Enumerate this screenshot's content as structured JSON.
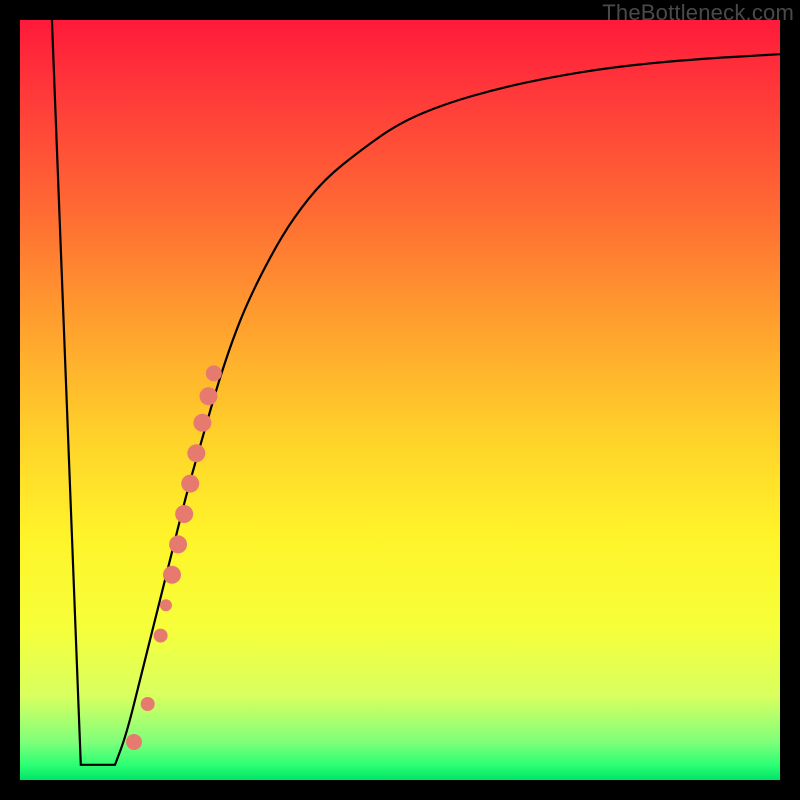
{
  "watermark": "TheBottleneck.com",
  "colors": {
    "curve_stroke": "#000000",
    "marker_fill": "#e77a6f",
    "marker_stroke": "#c95a4f"
  },
  "chart_data": {
    "type": "line",
    "title": "",
    "xlabel": "",
    "ylabel": "",
    "xlim": [
      0,
      100
    ],
    "ylim": [
      0,
      100
    ],
    "curve": {
      "x": [
        4.2,
        8.0,
        10.0,
        11.8,
        14.0,
        16.0,
        18.0,
        20.0,
        22.0,
        24.0,
        26.0,
        28.0,
        30.0,
        33.0,
        36.0,
        40.0,
        45.0,
        50.0,
        56.0,
        63.0,
        70.0,
        78.0,
        88.0,
        100.0
      ],
      "y": [
        100.0,
        4.0,
        2.0,
        2.0,
        6.0,
        14.0,
        22.0,
        30.0,
        38.0,
        45.0,
        52.0,
        58.0,
        63.0,
        69.0,
        74.0,
        79.0,
        83.0,
        86.5,
        89.0,
        91.0,
        92.5,
        93.8,
        94.8,
        95.5
      ]
    },
    "bottom_flat": {
      "x_start": 8.0,
      "x_end": 12.5,
      "y": 2.0
    },
    "series": [
      {
        "name": "markers",
        "points": [
          {
            "x": 15.0,
            "y": 5.0,
            "r": 8
          },
          {
            "x": 16.8,
            "y": 10.0,
            "r": 7
          },
          {
            "x": 18.5,
            "y": 19.0,
            "r": 7
          },
          {
            "x": 19.2,
            "y": 23.0,
            "r": 6
          },
          {
            "x": 20.0,
            "y": 27.0,
            "r": 9
          },
          {
            "x": 20.8,
            "y": 31.0,
            "r": 9
          },
          {
            "x": 21.6,
            "y": 35.0,
            "r": 9
          },
          {
            "x": 22.4,
            "y": 39.0,
            "r": 9
          },
          {
            "x": 23.2,
            "y": 43.0,
            "r": 9
          },
          {
            "x": 24.0,
            "y": 47.0,
            "r": 9
          },
          {
            "x": 24.8,
            "y": 50.5,
            "r": 9
          },
          {
            "x": 25.5,
            "y": 53.5,
            "r": 8
          }
        ]
      }
    ]
  }
}
